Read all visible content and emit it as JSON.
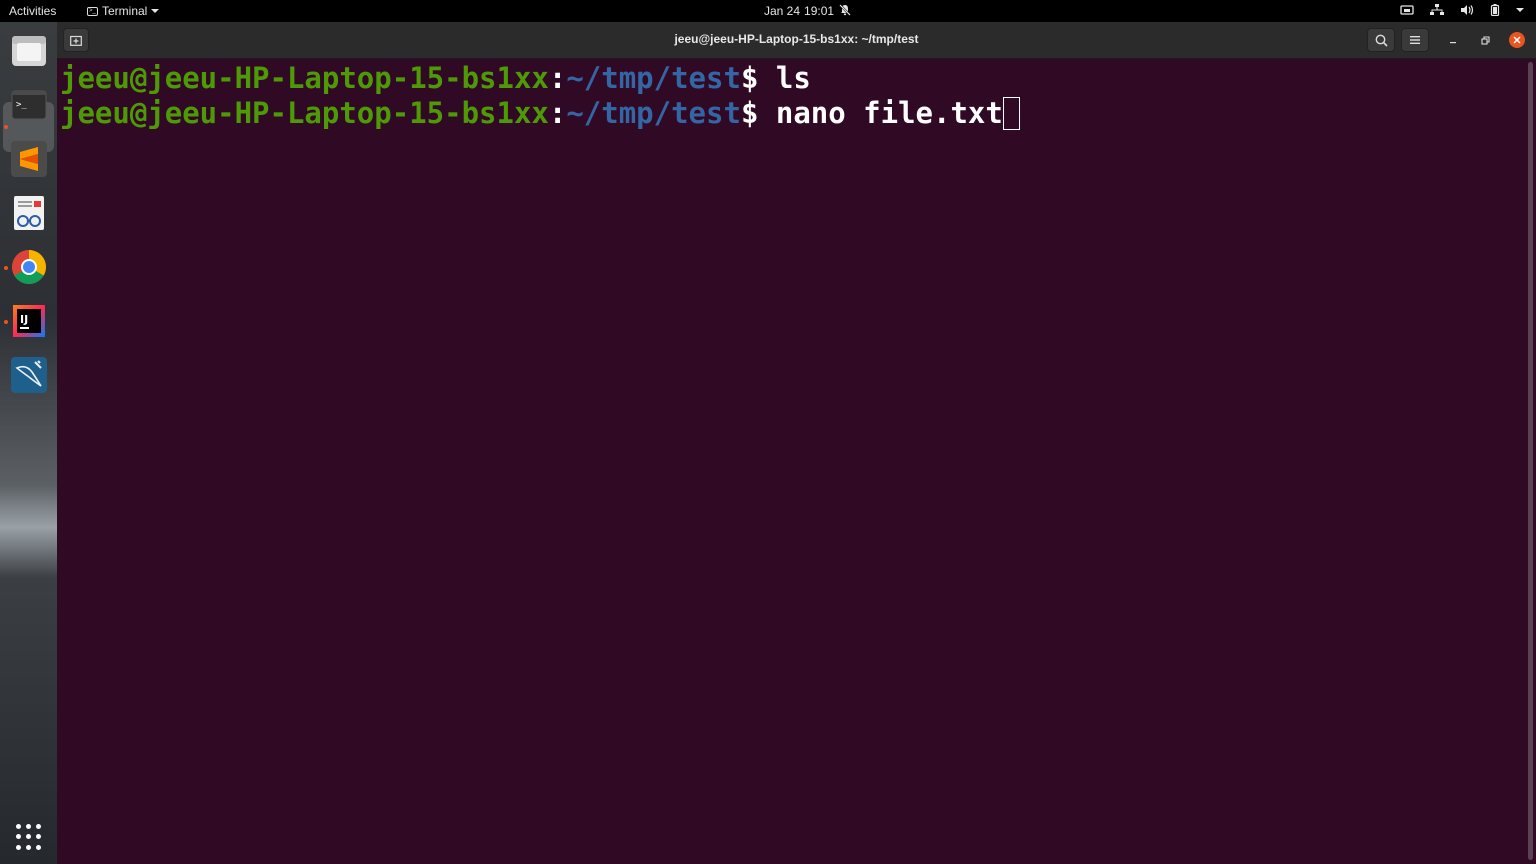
{
  "topbar": {
    "activities": "Activities",
    "app_menu": "Terminal",
    "date": "Jan 24",
    "time": "19:01"
  },
  "dock": {
    "items": [
      {
        "name": "files-icon",
        "running": false
      },
      {
        "name": "terminal-icon",
        "running": true,
        "active": true
      },
      {
        "name": "sublime-text-icon",
        "running": false
      },
      {
        "name": "document-viewer-icon",
        "running": false
      },
      {
        "name": "chrome-icon",
        "running": true
      },
      {
        "name": "intellij-icon",
        "running": true
      },
      {
        "name": "mysql-workbench-icon",
        "running": false
      }
    ]
  },
  "window": {
    "title": "jeeu@jeeu-HP-Laptop-15-bs1xx: ~/tmp/test"
  },
  "terminal": {
    "lines": [
      {
        "user": "jeeu@jeeu-HP-Laptop-15-bs1xx",
        "sep": ":",
        "path": "~/tmp/test",
        "prompt": "$ ",
        "command": "ls"
      },
      {
        "user": "jeeu@jeeu-HP-Laptop-15-bs1xx",
        "sep": ":",
        "path": "~/tmp/test",
        "prompt": "$ ",
        "command": "nano file.txt"
      }
    ]
  },
  "colors": {
    "terminal_bg": "#300a24",
    "user": "#4e9a06",
    "path": "#3465a4",
    "accent": "#e95420"
  }
}
